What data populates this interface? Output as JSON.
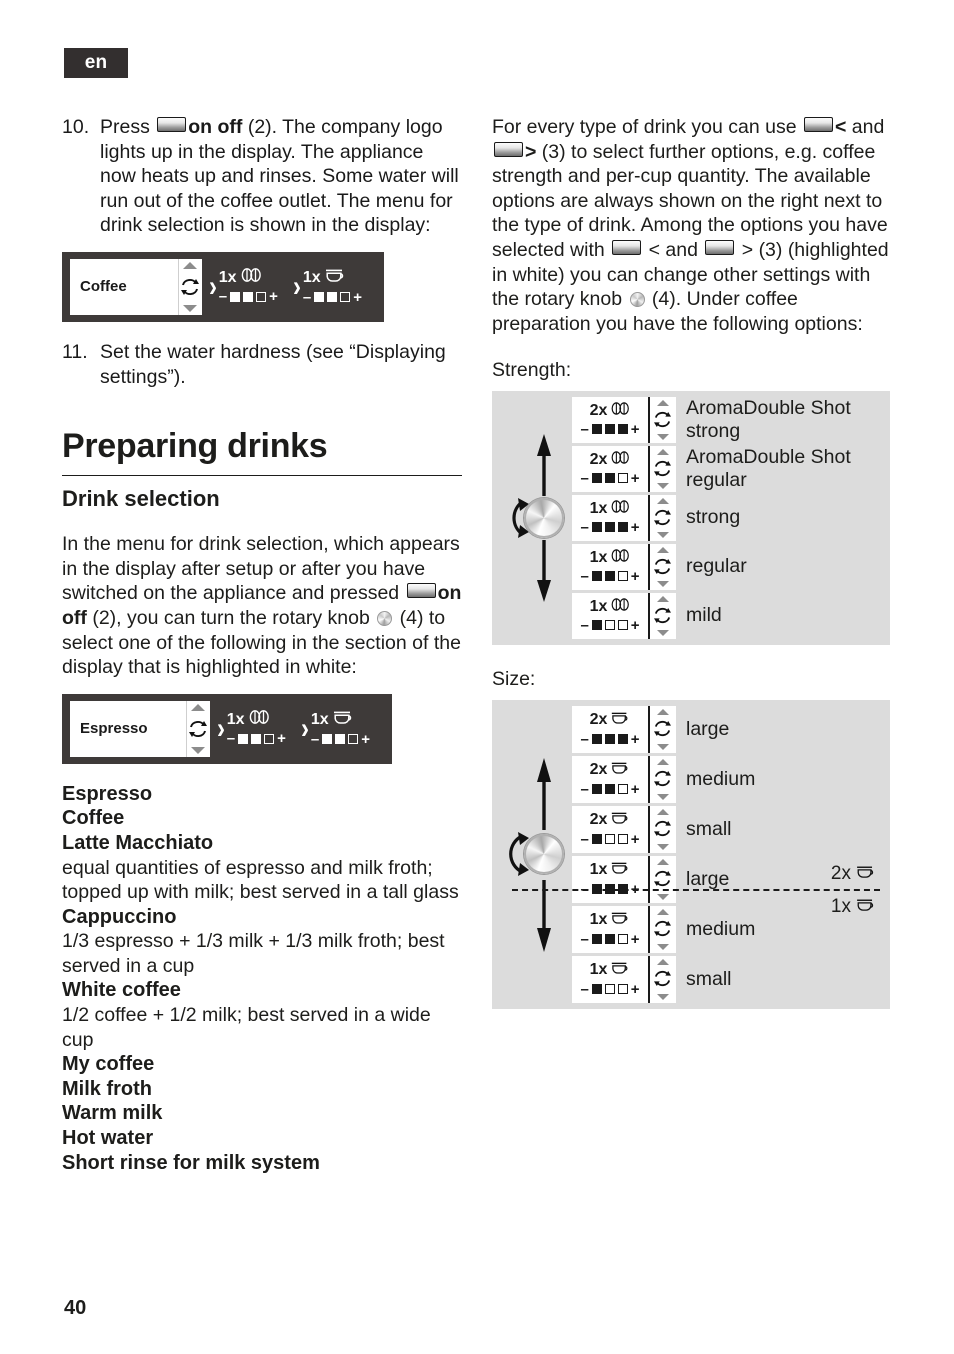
{
  "page": {
    "language_tab": "en",
    "page_number": "40"
  },
  "left_column": {
    "step10": {
      "number": "10.",
      "text_a": "Press ",
      "bold_a": "on off",
      "text_b": " (2). The company logo lights up in the display. The appliance now heats up and rinses. Some water will run out of the coffee outlet. The menu for drink selection is shown in the display:"
    },
    "display_coffee": {
      "drink": "Coffee",
      "option1": {
        "count": "1x",
        "icon": "coffee-bean-icon",
        "bars": [
          1,
          1,
          0
        ]
      },
      "option2": {
        "count": "1x",
        "icon": "cup-icon",
        "bars": [
          1,
          1,
          0
        ]
      }
    },
    "step11": {
      "number": "11.",
      "text": "Set the water hardness (see “Displaying settings”)."
    },
    "chapter_title": "Preparing drinks",
    "section_title": "Drink selection",
    "intro": {
      "text_a": "In the menu for drink selection, which appears in the display after setup or after you have switched on the appliance and pressed ",
      "bold_a": "on off",
      "text_b": " (2), you can turn the rotary knob ",
      "text_c": " (4) to select one of the following in the section of the display that is highlighted in white:"
    },
    "display_espresso": {
      "drink": "Espresso",
      "option1": {
        "count": "1x",
        "icon": "coffee-bean-icon",
        "bars": [
          1,
          1,
          0
        ]
      },
      "option2": {
        "count": "1x",
        "icon": "cup-icon",
        "bars": [
          1,
          1,
          0
        ]
      }
    },
    "drink_list": [
      {
        "name": "Espresso",
        "desc": ""
      },
      {
        "name": "Coffee",
        "desc": ""
      },
      {
        "name": "Latte Macchiato",
        "desc": "equal quantities of espresso and milk froth; topped up with milk; best served in a tall glass"
      },
      {
        "name": "Cappuccino",
        "desc": "1/3 espresso + 1/3 milk + 1/3 milk froth; best served in a cup"
      },
      {
        "name": "White coffee",
        "desc": "1/2 coffee + 1/2 milk; best served in a wide cup"
      },
      {
        "name": "My coffee",
        "desc": ""
      },
      {
        "name": "Milk froth",
        "desc": ""
      },
      {
        "name": "Warm milk",
        "desc": ""
      },
      {
        "name": "Hot water",
        "desc": ""
      },
      {
        "name": "Short rinse for milk system",
        "desc": ""
      }
    ]
  },
  "right_column": {
    "intro": {
      "text_a": "For every type of drink you can use ",
      "lt": "<",
      "text_b": " and ",
      "gt": ">",
      "text_c": " (3) to select further options, e.g. coffee strength and per-cup quantity. The available options are always shown on the right next to the type of drink. Among the options you have selected with ",
      "text_d": " < and ",
      "text_e": " > (3) (highlighted in white) you can change other settings with the rotary knob ",
      "text_f": " (4). Under coffee preparation you have the following options:"
    },
    "strength": {
      "label": "Strength:",
      "rows": [
        {
          "count": "2x",
          "icon": "coffee-bean-icon",
          "bars": [
            1,
            1,
            1
          ],
          "text": "AromaDouble Shot\nstrong"
        },
        {
          "count": "2x",
          "icon": "coffee-bean-icon",
          "bars": [
            1,
            1,
            0
          ],
          "text": "AromaDouble Shot\nregular"
        },
        {
          "count": "1x",
          "icon": "coffee-bean-icon",
          "bars": [
            1,
            1,
            1
          ],
          "text": "strong"
        },
        {
          "count": "1x",
          "icon": "coffee-bean-icon",
          "bars": [
            1,
            1,
            0
          ],
          "text": "regular"
        },
        {
          "count": "1x",
          "icon": "coffee-bean-icon",
          "bars": [
            1,
            0,
            0
          ],
          "text": "mild"
        }
      ]
    },
    "size": {
      "label": "Size:",
      "rows": [
        {
          "count": "2x",
          "icon": "cup-icon",
          "bars": [
            1,
            1,
            1
          ],
          "text": "large"
        },
        {
          "count": "2x",
          "icon": "cup-icon",
          "bars": [
            1,
            1,
            0
          ],
          "text": "medium"
        },
        {
          "count": "2x",
          "icon": "cup-icon",
          "bars": [
            1,
            0,
            0
          ],
          "text": "small"
        },
        {
          "count": "1x",
          "icon": "cup-icon",
          "bars": [
            1,
            1,
            1
          ],
          "text": "large"
        },
        {
          "count": "1x",
          "icon": "cup-icon",
          "bars": [
            1,
            1,
            0
          ],
          "text": "medium"
        },
        {
          "count": "1x",
          "icon": "cup-icon",
          "bars": [
            1,
            0,
            0
          ],
          "text": "small"
        }
      ],
      "divider_above_label": "2x",
      "divider_below_label": "1x"
    }
  },
  "colors": {
    "lcd_background": "#3e3a39",
    "panel_background": "#dcdcdc",
    "tab_background": "#332f2f",
    "text": "#1d1d1b"
  }
}
